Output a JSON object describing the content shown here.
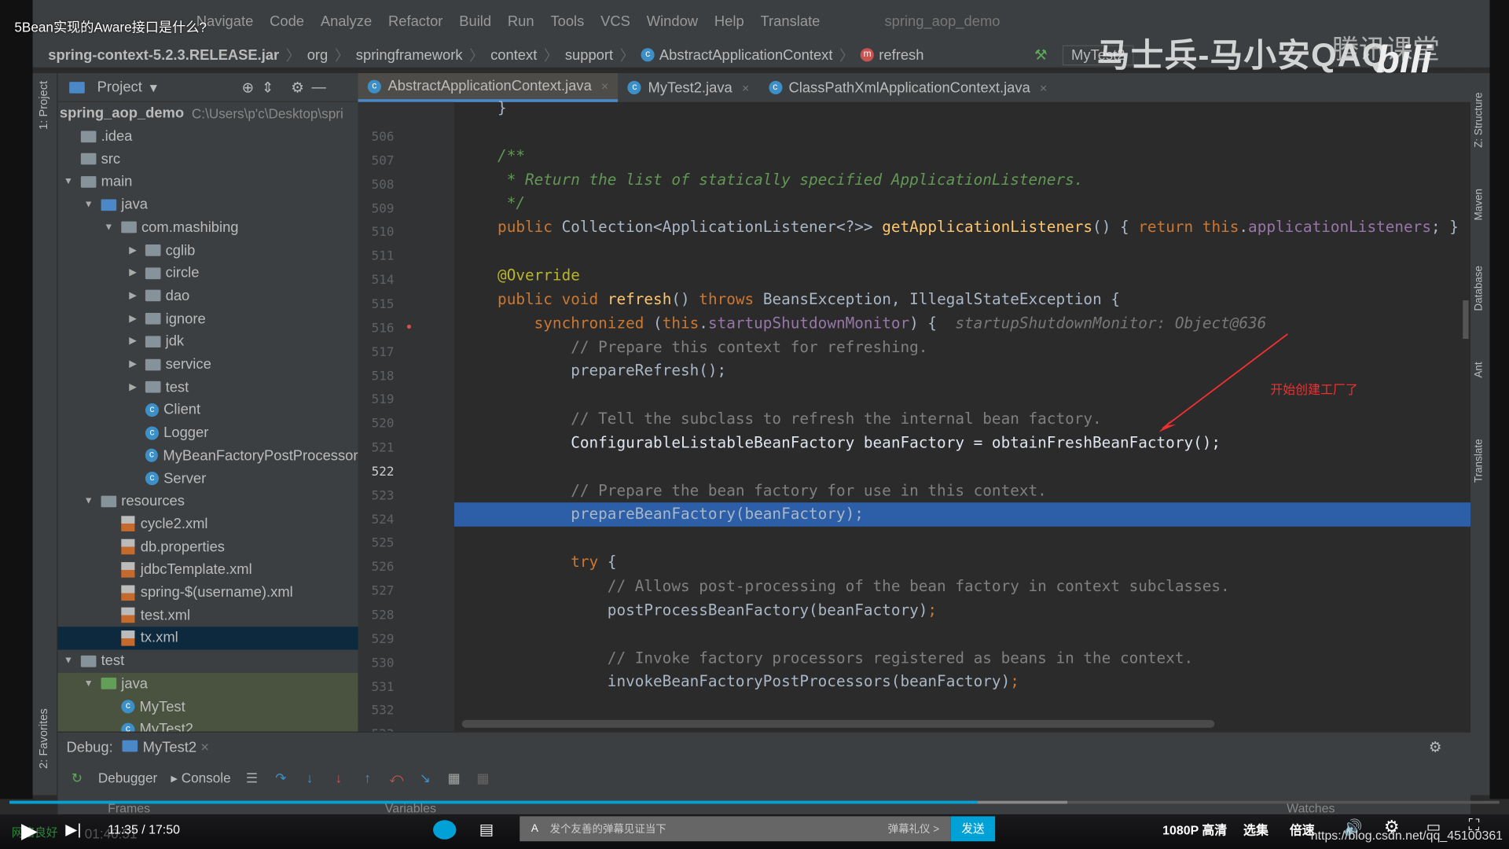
{
  "video": {
    "title": "5Bean实现的Aware接口是什么?",
    "time_current": "11:35",
    "time_total": "17:50",
    "time_sep": " / ",
    "progress_percent": 65,
    "buffered_percent": 71,
    "network": "网络良好",
    "elapsed": "01:40:51",
    "danmaku_placeholder": "发个友善的弹幕见证当下",
    "danmaku_etiquette": "弹幕礼仪 >",
    "send": "发送",
    "quality": "1080P 高清",
    "episodes": "选集",
    "speed": "倍速",
    "url": "https://blog.csdn.net/qq_45100361",
    "watermark": "马士兵-马小安QAQ",
    "brand2": "腾讯课堂",
    "brand": "bilibili",
    "accent": "#00a1d6"
  },
  "menu": {
    "items": [
      "Navigate",
      "Code",
      "Analyze",
      "Refactor",
      "Build",
      "Run",
      "Tools",
      "VCS",
      "Window",
      "Help",
      "Translate"
    ],
    "project": "spring_aop_demo"
  },
  "breadcrumb": [
    "spring-context-5.2.3.RELEASE.jar",
    "org",
    "springframework",
    "context",
    "support",
    "AbstractApplicationContext",
    "refresh"
  ],
  "run_config": "MyTest2",
  "project_panel": {
    "title": "Project",
    "side_label": "1: Project",
    "favorites": "2: Favorites",
    "tree": [
      {
        "d": 0,
        "a": "",
        "i": "module",
        "label": "spring_aop_demo",
        "extra": "C:\\Users\\p'c\\Desktop\\spri"
      },
      {
        "d": 0,
        "a": "",
        "i": "folder",
        "label": ".idea"
      },
      {
        "d": 0,
        "a": "",
        "i": "folder",
        "label": "src"
      },
      {
        "d": 0,
        "a": "open",
        "i": "folder",
        "label": "main"
      },
      {
        "d": 1,
        "a": "open",
        "i": "blue",
        "label": "java"
      },
      {
        "d": 2,
        "a": "open",
        "i": "folder",
        "label": "com.mashibing"
      },
      {
        "d": 3,
        "a": "closed",
        "i": "folder",
        "label": "cglib"
      },
      {
        "d": 3,
        "a": "closed",
        "i": "folder",
        "label": "circle"
      },
      {
        "d": 3,
        "a": "closed",
        "i": "folder",
        "label": "dao"
      },
      {
        "d": 3,
        "a": "closed",
        "i": "folder",
        "label": "ignore"
      },
      {
        "d": 3,
        "a": "closed",
        "i": "folder",
        "label": "jdk"
      },
      {
        "d": 3,
        "a": "closed",
        "i": "folder",
        "label": "service"
      },
      {
        "d": 3,
        "a": "closed",
        "i": "folder",
        "label": "test"
      },
      {
        "d": 3,
        "a": "",
        "i": "class",
        "label": "Client"
      },
      {
        "d": 3,
        "a": "",
        "i": "class",
        "label": "Logger"
      },
      {
        "d": 3,
        "a": "",
        "i": "class",
        "label": "MyBeanFactoryPostProcessor"
      },
      {
        "d": 3,
        "a": "",
        "i": "class",
        "label": "Server"
      },
      {
        "d": 1,
        "a": "open",
        "i": "folder",
        "label": "resources"
      },
      {
        "d": 2,
        "a": "",
        "i": "xml",
        "label": "cycle2.xml"
      },
      {
        "d": 2,
        "a": "",
        "i": "xml",
        "label": "db.properties"
      },
      {
        "d": 2,
        "a": "",
        "i": "xml",
        "label": "jdbcTemplate.xml"
      },
      {
        "d": 2,
        "a": "",
        "i": "xml",
        "label": "spring-$(username).xml"
      },
      {
        "d": 2,
        "a": "",
        "i": "xml",
        "label": "test.xml"
      },
      {
        "d": 2,
        "a": "",
        "i": "xml",
        "label": "tx.xml",
        "selected": true
      },
      {
        "d": 0,
        "a": "open",
        "i": "folder",
        "label": "test"
      },
      {
        "d": 1,
        "a": "open",
        "i": "green",
        "label": "java",
        "highlight": true
      },
      {
        "d": 2,
        "a": "",
        "i": "class",
        "label": "MyTest",
        "highlight": true
      },
      {
        "d": 2,
        "a": "",
        "i": "class",
        "label": "MyTest2",
        "highlight": true
      }
    ]
  },
  "tabs": [
    {
      "label": "AbstractApplicationContext.java",
      "active": true
    },
    {
      "label": "MyTest2.java"
    },
    {
      "label": "ClassPathXmlApplicationContext.java"
    }
  ],
  "code": [
    {
      "n": "506",
      "t": [
        [
          "}",
          ""
        ]
      ]
    },
    {
      "n": "507",
      "t": []
    },
    {
      "n": "508",
      "t": [
        [
          "/**",
          "doc"
        ]
      ]
    },
    {
      "n": "509",
      "t": [
        [
          " * Return the list of statically specified ApplicationListeners.",
          "doc"
        ]
      ]
    },
    {
      "n": "510",
      "t": [
        [
          " */",
          "doc"
        ]
      ]
    },
    {
      "n": "511",
      "t": [
        [
          "public ",
          "kw"
        ],
        [
          "Collection<ApplicationListener<?>> ",
          ""
        ],
        [
          "getApplicationListeners",
          "fn"
        ],
        [
          "() { ",
          ""
        ],
        [
          "return this",
          "kw"
        ],
        [
          ".",
          ""
        ],
        [
          "applicationListeners",
          "fld"
        ],
        [
          "; }",
          ""
        ]
      ]
    },
    {
      "n": "514",
      "t": []
    },
    {
      "n": "515",
      "t": [
        [
          "@Override",
          "an"
        ]
      ]
    },
    {
      "n": "516",
      "t": [
        [
          "public void ",
          "kw"
        ],
        [
          "refresh",
          "fn"
        ],
        [
          "() ",
          ""
        ],
        [
          "throws ",
          "kw"
        ],
        [
          "BeansException, IllegalStateException {",
          ""
        ]
      ]
    },
    {
      "n": "517",
      "t": [
        [
          "    synchronized ",
          "kw"
        ],
        [
          "(",
          ""
        ],
        [
          "this",
          "kw"
        ],
        [
          ".",
          ""
        ],
        [
          "startupShutdownMonitor",
          "fld"
        ],
        [
          ") {  ",
          ""
        ],
        [
          "startupShutdownMonitor: Object@636",
          "hint"
        ]
      ]
    },
    {
      "n": "518",
      "t": [
        [
          "        // Prepare this context for refreshing.",
          "cm"
        ]
      ]
    },
    {
      "n": "519",
      "t": [
        [
          "        prepareRefresh();",
          ""
        ]
      ]
    },
    {
      "n": "520",
      "t": []
    },
    {
      "n": "521",
      "t": [
        [
          "        // Tell the subclass to refresh the internal bean factory.",
          "cm"
        ]
      ]
    },
    {
      "n": "522",
      "t": [
        [
          "        ConfigurableListableBeanFactory beanFactory = obtainFreshBeanFactory();",
          ""
        ]
      ],
      "current": true
    },
    {
      "n": "523",
      "t": []
    },
    {
      "n": "524",
      "t": [
        [
          "        // Prepare the bean factory for use in this context.",
          "cm"
        ]
      ]
    },
    {
      "n": "525",
      "t": [
        [
          "        prepareBeanFactory(beanFactory);",
          ""
        ]
      ]
    },
    {
      "n": "526",
      "t": []
    },
    {
      "n": "527",
      "t": [
        [
          "        try ",
          "kw"
        ],
        [
          "{",
          ""
        ]
      ]
    },
    {
      "n": "528",
      "t": [
        [
          "            // Allows post-processing of the bean factory in context subclasses.",
          "cm"
        ]
      ]
    },
    {
      "n": "529",
      "t": [
        [
          "            postProcessBeanFactory(beanFactory)",
          ""
        ],
        [
          ";",
          "kw"
        ]
      ]
    },
    {
      "n": "530",
      "t": []
    },
    {
      "n": "531",
      "t": [
        [
          "            // Invoke factory processors registered as beans in the context.",
          "cm"
        ]
      ]
    },
    {
      "n": "532",
      "t": [
        [
          "            invokeBeanFactoryPostProcessors(beanFactory)",
          ""
        ],
        [
          ";",
          "kw"
        ]
      ]
    },
    {
      "n": "533",
      "t": []
    }
  ],
  "annotation": "开始创建工厂了",
  "right_tools": [
    "Z: Structure",
    "Maven",
    "Database",
    "Ant",
    "Translate"
  ],
  "debug": {
    "label": "Debug:",
    "session": "MyTest2",
    "tabs": [
      "Debugger",
      "Console"
    ],
    "columns": [
      "Frames",
      "Variables",
      "Watches"
    ]
  }
}
